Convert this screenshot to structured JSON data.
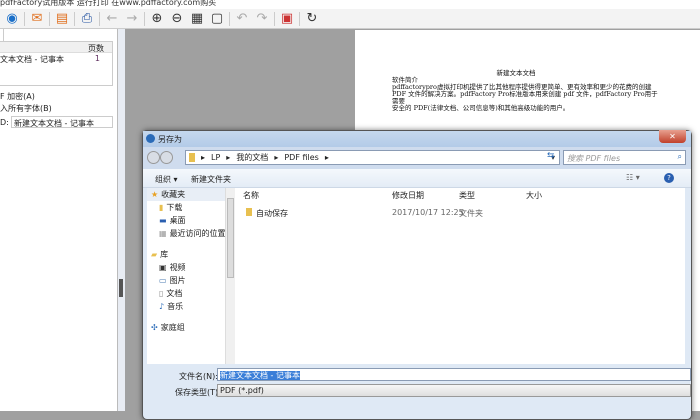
{
  "window": {
    "title": "pdfFactory试用版本 运行打印 在www.pdffactory.com购买"
  },
  "toolbar": {
    "icons": [
      "send-icon",
      "email-icon",
      "save-icon",
      "print-icon",
      "back-icon",
      "forward-icon",
      "zoom-in-icon",
      "zoom-out-icon",
      "thumbnails-icon",
      "fit-page-icon",
      "undo-icon",
      "redo-icon",
      "delete-page-icon",
      "refresh-icon"
    ]
  },
  "left_panel": {
    "col_pages": "页数",
    "doc_name": "文本文档 - 记事本",
    "doc_pages": "1",
    "encrypt": "F 加密(A)",
    "embed_fonts": "入所有字体(B)",
    "title_label": "D:",
    "title_value": "新建文本文档 - 记事本"
  },
  "page": {
    "title": "新建文本文档",
    "lines": [
      "软件简介",
      "pdffactorypro虚拟打印机提供了比其他程序提供得更简单、更有效率和更少的花费的创建",
      "PDF 文件的解决方案。pdfFactory Pro标准版本用来创建 pdf 文件，pdfFactory Pro用于",
      "需要",
      "安全的 PDF(法律文档、公司信息等)和其他高级功能的用户。"
    ]
  },
  "dialog": {
    "title": "另存为",
    "breadcrumb": [
      "LP",
      "我的文档",
      "PDF files"
    ],
    "search_placeholder": "搜索 PDF files",
    "organize": "组织 ▾",
    "new_folder": "新建文件夹",
    "nav": [
      {
        "label": "收藏夹",
        "icon": "star-icon",
        "level": 0
      },
      {
        "label": "下载",
        "icon": "download-folder-icon",
        "level": 1
      },
      {
        "label": "桌面",
        "icon": "desktop-icon",
        "level": 1
      },
      {
        "label": "最近访问的位置",
        "icon": "recent-places-icon",
        "level": 1
      },
      {
        "label": "库",
        "icon": "library-icon",
        "level": 0,
        "gap": true
      },
      {
        "label": "视频",
        "icon": "video-icon",
        "level": 1
      },
      {
        "label": "图片",
        "icon": "pictures-icon",
        "level": 1
      },
      {
        "label": "文档",
        "icon": "documents-icon",
        "level": 1
      },
      {
        "label": "音乐",
        "icon": "music-icon",
        "level": 1
      },
      {
        "label": "家庭组",
        "icon": "homegroup-icon",
        "level": 0,
        "gap": true
      }
    ],
    "columns": [
      "名称",
      "修改日期",
      "类型",
      "大小"
    ],
    "files": [
      {
        "name": "自动保存",
        "date": "2017/10/17 12:25",
        "type": "文件夹",
        "size": ""
      }
    ],
    "filename_label": "文件名(N):",
    "filename_value": "新建文本文档 - 记事本",
    "filetype_label": "保存类型(T):",
    "filetype_value": "PDF (*.pdf)"
  }
}
